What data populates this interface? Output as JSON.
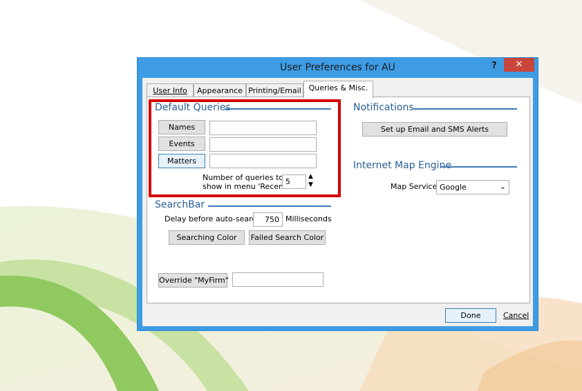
{
  "window": {
    "title": "User Preferences for AU",
    "help_label": "?",
    "close_label": "✕"
  },
  "tabs": [
    {
      "label": "User Info",
      "active": false
    },
    {
      "label": "Appearance",
      "active": false
    },
    {
      "label": "Printing/Email",
      "active": false
    },
    {
      "label": "Queries & Misc.",
      "active": true
    }
  ],
  "default_queries": {
    "title": "Default Queries",
    "names_label": "Names",
    "names_value": "",
    "events_label": "Events",
    "events_value": "",
    "matters_label": "Matters",
    "matters_value": "",
    "recent_label_line1": "Number of queries to",
    "recent_label_line2": "show in menu 'Recent'",
    "recent_value": "5"
  },
  "searchbar": {
    "title": "SearchBar",
    "delay_label": "Delay before auto-search",
    "delay_value": "750",
    "delay_unit": "Milliseconds",
    "searching_color_label": "Searching Color",
    "failed_color_label": "Failed Search Color"
  },
  "override": {
    "button_label": "Override \"MyFirm\"",
    "value": ""
  },
  "notifications": {
    "title": "Notifications",
    "setup_label": "Set up Email and SMS Alerts"
  },
  "map_engine": {
    "title": "Internet Map Engine",
    "service_label": "Map Service:",
    "service_value": "Google"
  },
  "footer": {
    "done_label": "Done",
    "cancel_label": "Cancel"
  },
  "colors": {
    "titlebar": "#3e9ce5",
    "close": "#c8463b",
    "group_title": "#2b5e93",
    "highlight": "#d40000"
  }
}
